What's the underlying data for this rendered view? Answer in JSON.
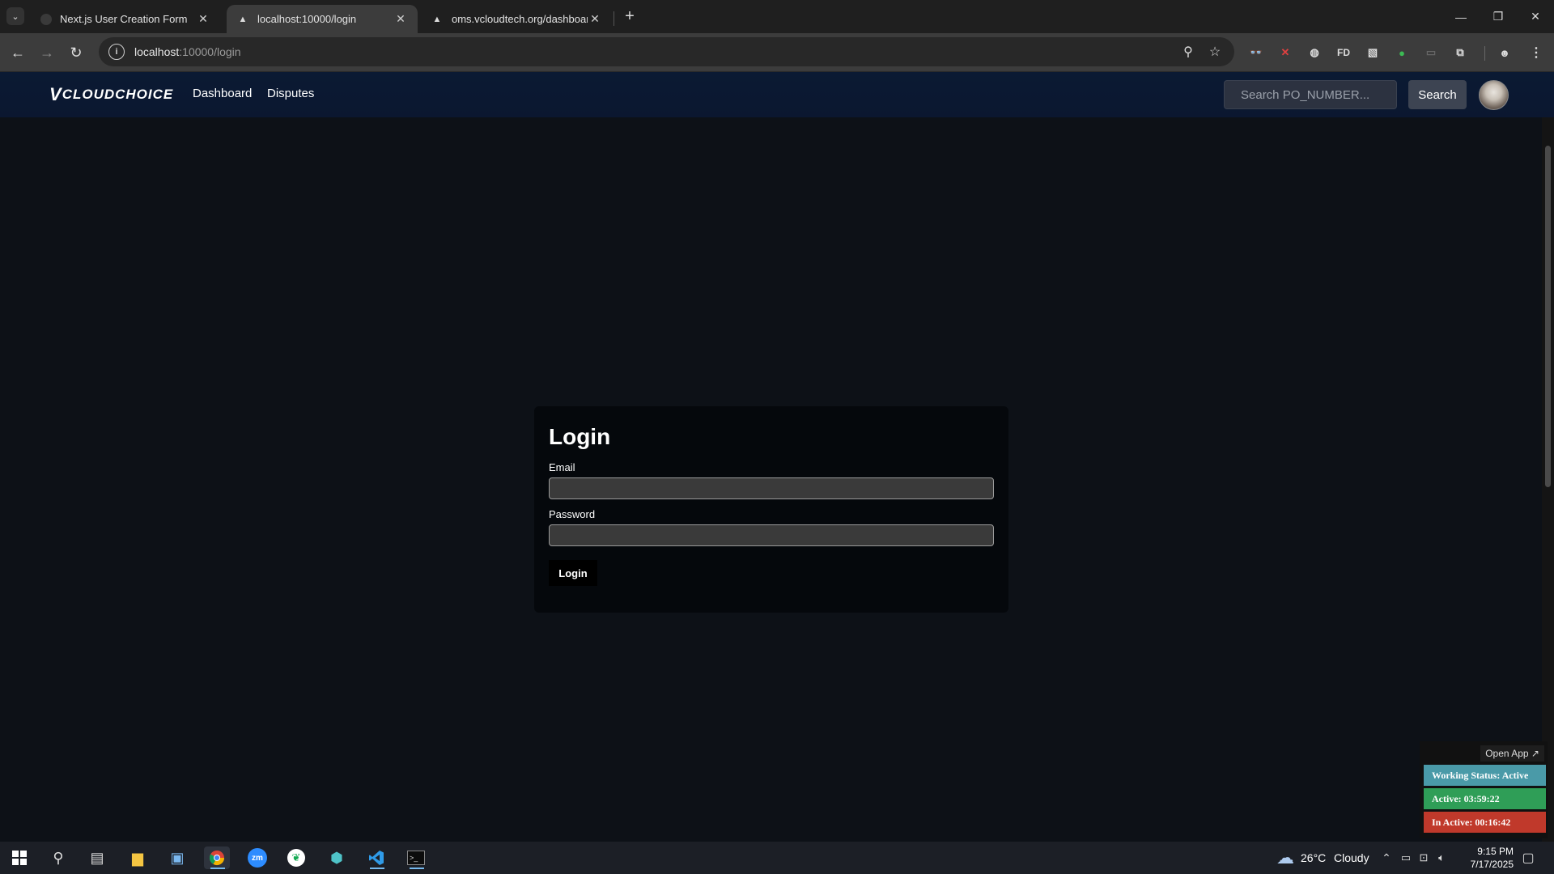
{
  "browser": {
    "tabs": [
      {
        "title": "Next.js User Creation Form"
      },
      {
        "title": "localhost:10000/login"
      },
      {
        "title": "oms.vcloudtech.org/dashboard"
      }
    ],
    "url_host": "localhost",
    "url_path": ":10000/login"
  },
  "app": {
    "logo_mark": "V",
    "logo_text": "CLOUDCHOICE",
    "nav": {
      "dashboard": "Dashboard",
      "disputes": "Disputes"
    },
    "search_placeholder": "Search PO_NUMBER...",
    "search_button": "Search"
  },
  "login": {
    "title": "Login",
    "email_label": "Email",
    "email_value": "",
    "password_label": "Password",
    "password_value": "",
    "submit_label": "Login"
  },
  "widget": {
    "open_app": "Open App ↗",
    "working_status": "Working Status: Active",
    "active": "Active: 03:59:22",
    "inactive": "In Active: 00:16:42",
    "colors": {
      "working": "#4a9aa8",
      "active": "#2f9e57",
      "inactive": "#c0392b"
    }
  },
  "taskbar": {
    "weather_temp": "26°C",
    "weather_desc": "Cloudy",
    "time": "9:15 PM",
    "date": "7/17/2025"
  }
}
